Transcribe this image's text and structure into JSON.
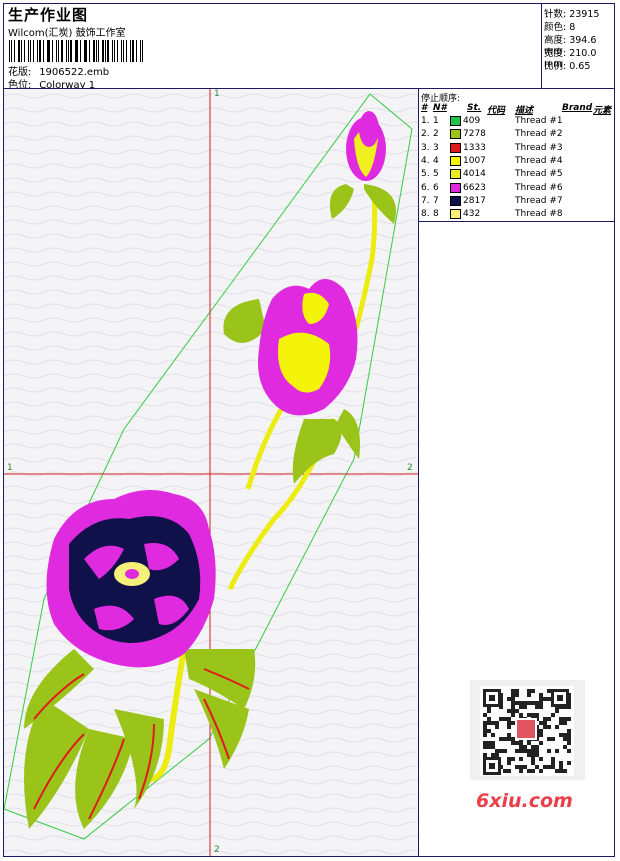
{
  "header": {
    "title": "生产作业图",
    "studio": "Wilcom(汇炭) 鼓饰工作室",
    "design_label": "花版:",
    "design_value": "1906522.emb",
    "color_label": "色位:",
    "color_value": "Colorway 1"
  },
  "stats": {
    "stitches": "针数: 23915",
    "colors": "颜色: 8",
    "height": "高度: 394.6 mm",
    "width": "宽度: 210.0 mm",
    "scale": "比例: 0.65"
  },
  "stops": {
    "heading": "停止顺序:",
    "col_hash": "#",
    "col_n": "N#",
    "col_st": "St.",
    "col_code": "代码",
    "col_desc": "描述",
    "col_brand": "Brand",
    "col_elem": "元素",
    "rows": [
      {
        "idx": "1.",
        "n": "1",
        "code": "409",
        "desc": "Thread #1",
        "color": "#22c24a"
      },
      {
        "idx": "2.",
        "n": "2",
        "code": "7278",
        "desc": "Thread #2",
        "color": "#9bc41a"
      },
      {
        "idx": "3.",
        "n": "3",
        "code": "1333",
        "desc": "Thread #3",
        "color": "#e01a1a"
      },
      {
        "idx": "4.",
        "n": "4",
        "code": "1007",
        "desc": "Thread #4",
        "color": "#f4f40a"
      },
      {
        "idx": "5.",
        "n": "5",
        "code": "4014",
        "desc": "Thread #5",
        "color": "#ecec22"
      },
      {
        "idx": "6.",
        "n": "6",
        "code": "6623",
        "desc": "Thread #6",
        "color": "#e02ae0"
      },
      {
        "idx": "7.",
        "n": "7",
        "code": "2817",
        "desc": "Thread #7",
        "color": "#10104a"
      },
      {
        "idx": "8.",
        "n": "8",
        "code": "432",
        "desc": "Thread #8",
        "color": "#f6f07a"
      }
    ]
  },
  "axes": {
    "top": "1",
    "left": "1",
    "right": "2",
    "bottom": "2"
  },
  "watermark": "6xiu.com"
}
